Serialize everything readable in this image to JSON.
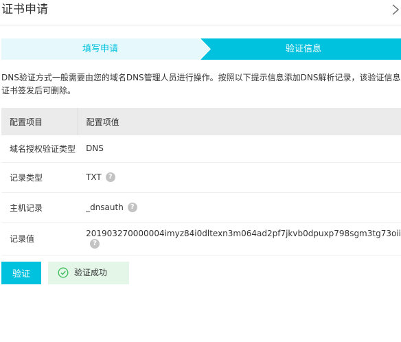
{
  "header": {
    "title": "证书申请",
    "close_icon": "chevron-right-icon"
  },
  "steps": [
    {
      "label": "填写申请",
      "state": "completed"
    },
    {
      "label": "验证信息",
      "state": "active"
    }
  ],
  "colors": {
    "accent": "#00c1de",
    "step_completed_bg": "#e6f8fb",
    "success_bg": "#e3f6e8",
    "success_icon": "#3dbd5e"
  },
  "description": {
    "line1": "DNS验证方式一般需要由您的域名DNS管理人员进行操作。按照以下提示信息添加DNS解析记录，该验证信息在",
    "line2": "证书签发后可删除。"
  },
  "table": {
    "headers": [
      "配置项目",
      "配置项值"
    ],
    "rows": [
      {
        "item": "域名授权验证类型",
        "value": "DNS",
        "help": false
      },
      {
        "item": "记录类型",
        "value": "TXT",
        "help": true
      },
      {
        "item": "主机记录",
        "value": "_dnsauth",
        "help": true
      },
      {
        "item": "记录值",
        "value": "201903270000004imyz84i0dltexn3m064ad2pf7jkvb0dpuxp798sgm3tg73oii",
        "help": true
      }
    ],
    "help_glyph": "?"
  },
  "actions": {
    "verify_label": "验证",
    "success_label": "验证成功",
    "success_icon": "check-circle-icon"
  }
}
